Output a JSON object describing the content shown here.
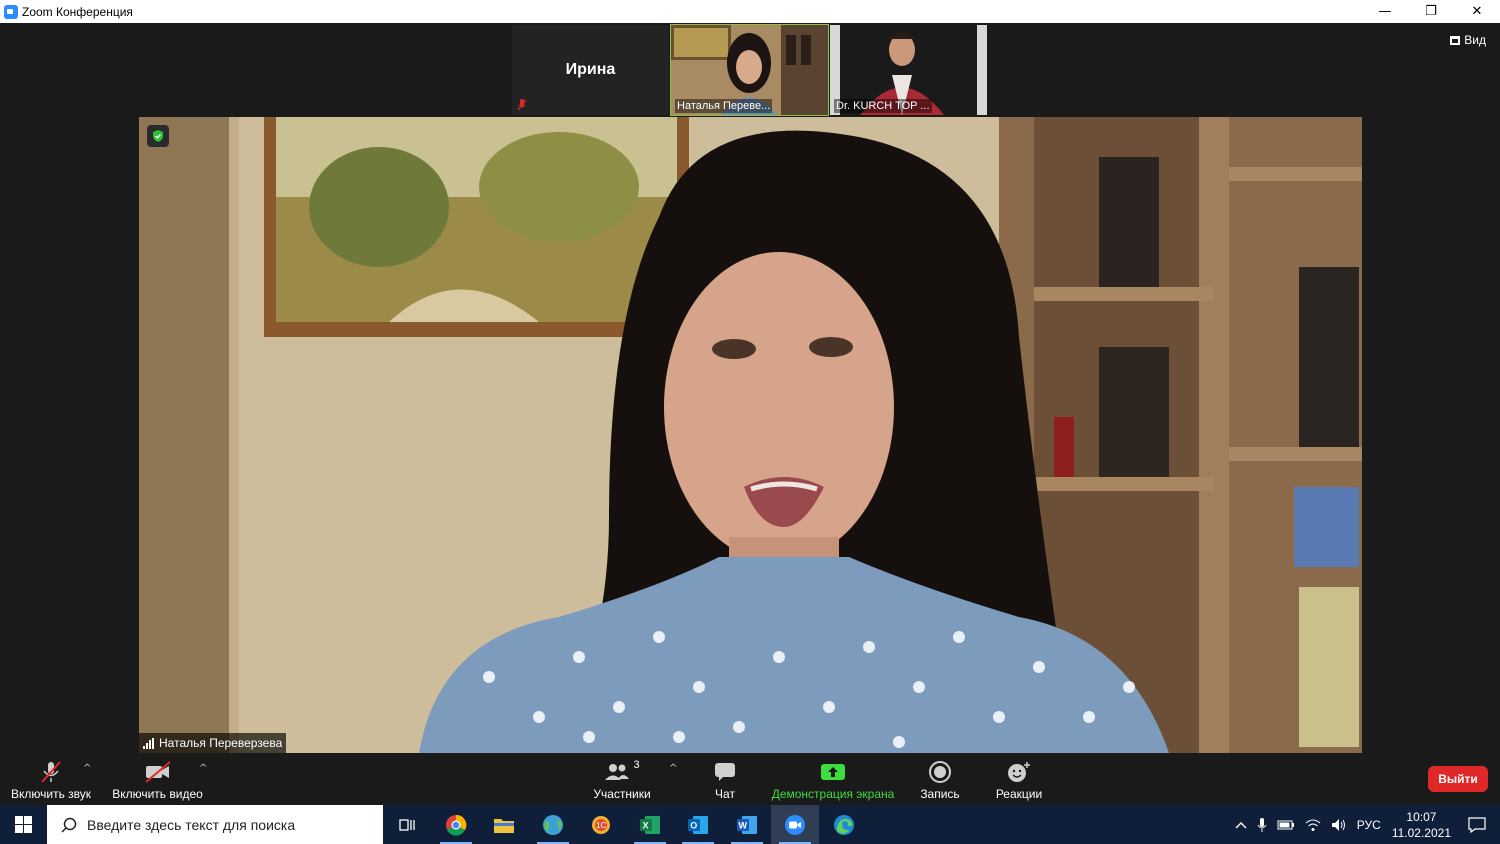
{
  "window": {
    "title": "Zoom Конференция",
    "minimize": "—",
    "restore": "❐",
    "close": "✕"
  },
  "view_button": {
    "label": "Вид"
  },
  "thumbnails": [
    {
      "name": "Ирина",
      "mic_muted": true
    },
    {
      "name": "Наталья Переве...",
      "active": true
    },
    {
      "name": "Dr. KURCH TOP ..."
    }
  ],
  "main_video": {
    "speaker": "Наталья Переверзева"
  },
  "toolbar": {
    "unmute_label": "Включить звук",
    "start_video_label": "Включить видео",
    "participants_label": "Участники",
    "participants_count": "3",
    "chat_label": "Чат",
    "share_label": "Демонстрация экрана",
    "record_label": "Запись",
    "reactions_label": "Реакции",
    "leave_label": "Выйти"
  },
  "taskbar": {
    "search_placeholder": "Введите здесь текст для поиска",
    "language": "РУС",
    "time": "10:07",
    "date": "11.02.2021",
    "apps": [
      "task-view",
      "chrome",
      "file-explorer",
      "globe-app",
      "ie-app",
      "excel",
      "outlook",
      "word",
      "zoom",
      "edge"
    ]
  },
  "colors": {
    "accent": "#2d8cff",
    "share_green": "#3fdc3f",
    "leave_red": "#e02828",
    "taskbar": "#0f1f3a"
  }
}
